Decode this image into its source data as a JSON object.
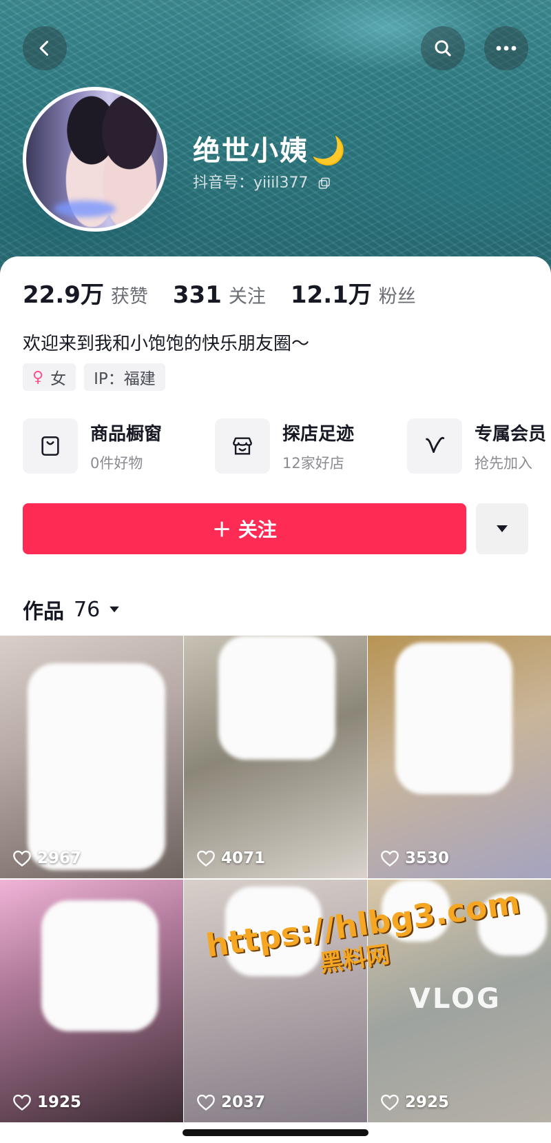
{
  "profile": {
    "nickname": "绝世小姨",
    "nickname_emoji": "🌙",
    "douyin_id": "抖音号：yiiil377"
  },
  "stats": [
    {
      "value": "22.9万",
      "label": "获赞"
    },
    {
      "value": "331",
      "label": "关注"
    },
    {
      "value": "12.1万",
      "label": "粉丝"
    }
  ],
  "bio": "欢迎来到我和小饱饱的快乐朋友圈～",
  "tags": {
    "gender": "女",
    "ip": "IP：福建"
  },
  "services": [
    {
      "title": "商品橱窗",
      "sub": "0件好物",
      "icon": "shop-bag-icon"
    },
    {
      "title": "探店足迹",
      "sub": "12家好店",
      "icon": "store-icon"
    },
    {
      "title": "专属会员",
      "sub": "抢先加入",
      "icon": "vip-v-icon"
    }
  ],
  "follow_label": "＋ 关注",
  "works": {
    "label": "作品",
    "count": "76"
  },
  "videos": [
    {
      "likes": "2967"
    },
    {
      "likes": "4071"
    },
    {
      "likes": "3530"
    },
    {
      "likes": "1925"
    },
    {
      "likes": "2037"
    },
    {
      "likes": "2925",
      "overlay": "VLOG"
    }
  ],
  "watermark": {
    "url": "https://hlbg3.com",
    "site": "黑料网"
  },
  "colors": {
    "follow_button": "#fe2c55",
    "watermark": "#f5a623"
  }
}
